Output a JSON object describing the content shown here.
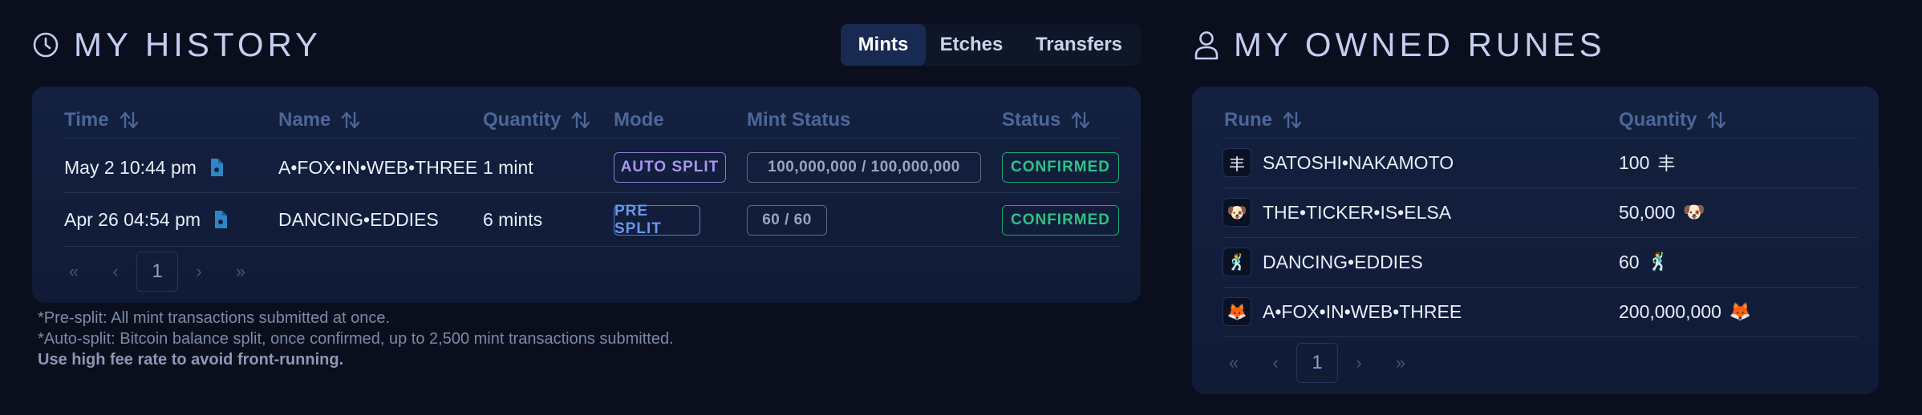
{
  "history": {
    "title": "MY HISTORY",
    "tabs": [
      {
        "label": "Mints",
        "active": true
      },
      {
        "label": "Etches",
        "active": false
      },
      {
        "label": "Transfers",
        "active": false
      }
    ],
    "columns": [
      "Time",
      "Name",
      "Quantity",
      "Mode",
      "Mint Status",
      "Status"
    ],
    "rows": [
      {
        "time": "May 2 10:44 pm",
        "name": "A•FOX•IN•WEB•THREE",
        "quantity": "1 mint",
        "mode": "AUTO SPLIT",
        "mint_status": "100,000,000 / 100,000,000",
        "status": "CONFIRMED"
      },
      {
        "time": "Apr 26 04:54 pm",
        "name": "DANCING•EDDIES",
        "quantity": "6 mints",
        "mode": "PRE SPLIT",
        "mint_status": "60 / 60",
        "status": "CONFIRMED"
      }
    ],
    "pagination": {
      "current_page": "1",
      "first": "«",
      "prev": "‹",
      "next": "›",
      "last": "»"
    },
    "notes": [
      "*Pre-split: All mint transactions submitted at once.",
      "*Auto-split: Bitcoin balance split, once confirmed, up to 2,500 mint transactions submitted.",
      "Use high fee rate to avoid front-running."
    ]
  },
  "runes": {
    "title": "MY OWNED RUNES",
    "columns": [
      "Rune",
      "Quantity"
    ],
    "rows": [
      {
        "symbol": "丰",
        "name": "SATOSHI•NAKAMOTO",
        "quantity": "100"
      },
      {
        "symbol": "🐶",
        "name": "THE•TICKER•IS•ELSA",
        "quantity": "50,000"
      },
      {
        "symbol": "🕺",
        "name": "DANCING•EDDIES",
        "quantity": "60"
      },
      {
        "symbol": "🦊",
        "name": "A•FOX•IN•WEB•THREE",
        "quantity": "200,000,000"
      }
    ],
    "pagination": {
      "current_page": "1",
      "first": "«",
      "prev": "‹",
      "next": "›",
      "last": "»"
    }
  },
  "colors": {
    "background": "#0b0f1d",
    "panel": "#13203f",
    "header_text": "#4d6699",
    "confirmed": "#2dc287",
    "auto_split": "#a996f0",
    "pre_split": "#6a96e8",
    "active_tab": "#182a52"
  },
  "icons": {
    "history": "clock-icon",
    "runes": "user-icon",
    "sort": "sort-arrows-icon",
    "tx": "document-icon"
  }
}
